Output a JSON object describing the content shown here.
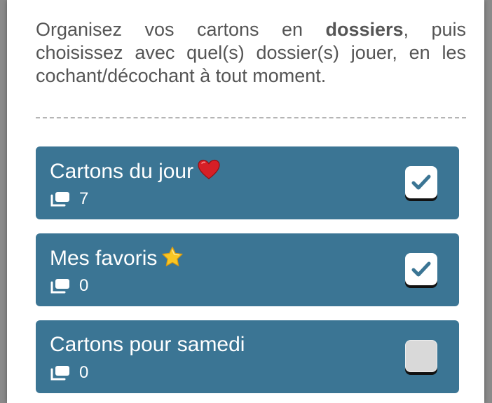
{
  "intro": {
    "part1": "Organisez vos cartons en ",
    "bold": "dossiers",
    "part2": ", puis choisissez avec quel(s) dossier(s) jouer, en les cochant/décochant à tout moment."
  },
  "folders": [
    {
      "title": "Cartons du jour",
      "emoji": "heart-icon",
      "count": "7",
      "checked": true
    },
    {
      "title": "Mes favoris",
      "emoji": "star-icon",
      "count": "0",
      "checked": true
    },
    {
      "title": "Cartons pour samedi",
      "emoji": "",
      "count": "0",
      "checked": false
    }
  ],
  "colors": {
    "folder_bg": "#3b7594",
    "text": "#555555",
    "checkmark": "#3b7594"
  }
}
